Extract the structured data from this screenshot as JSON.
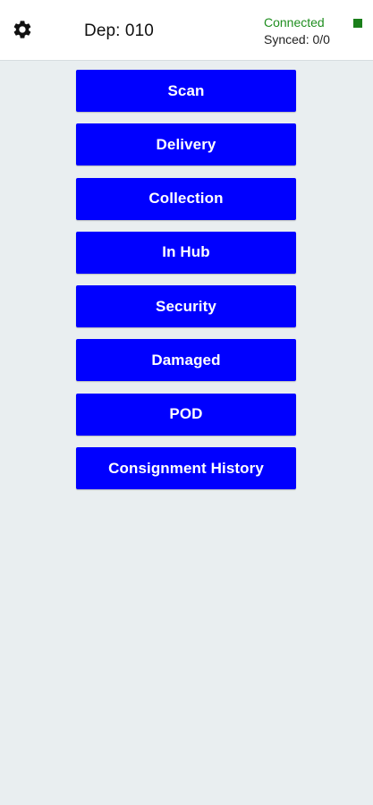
{
  "header": {
    "settings_icon": "gear-icon",
    "dep_label": "Dep: 010",
    "connection_status": "Connected",
    "sync_status": "Synced: 0/0",
    "connection_color": "#1a7f1a"
  },
  "menu": {
    "items": [
      {
        "label": "Scan"
      },
      {
        "label": "Delivery"
      },
      {
        "label": "Collection"
      },
      {
        "label": "In Hub"
      },
      {
        "label": "Security"
      },
      {
        "label": "Damaged"
      },
      {
        "label": "POD"
      },
      {
        "label": "Consignment History"
      }
    ],
    "button_color": "#0000ff",
    "text_color": "#ffffff"
  },
  "theme": {
    "background": "#e9eef0",
    "header_background": "#ffffff"
  }
}
